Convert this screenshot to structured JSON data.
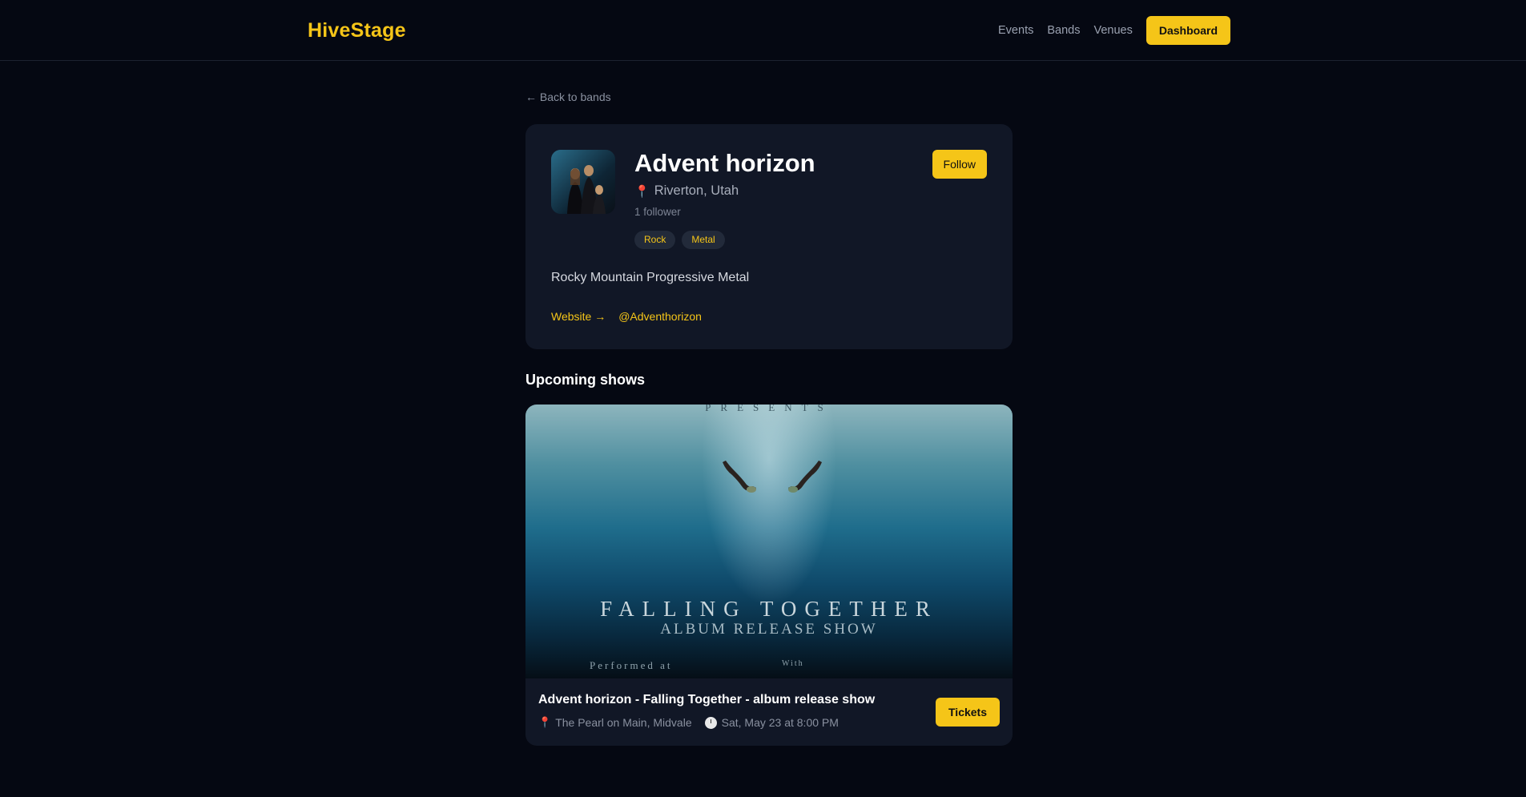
{
  "header": {
    "brand": "HiveStage",
    "nav": [
      "Events",
      "Bands",
      "Venues"
    ],
    "dashboard_label": "Dashboard"
  },
  "back_link": "← Back to bands",
  "band": {
    "name": "Advent horizon",
    "location": "Riverton, Utah",
    "followers": "1 follower",
    "tags": [
      "Rock",
      "Metal"
    ],
    "follow_label": "Follow",
    "bio": "Rocky Mountain Progressive Metal",
    "links": [
      "Website →",
      "@Adventhorizon"
    ]
  },
  "upcoming": {
    "title": "Upcoming shows",
    "shows": [
      {
        "poster_top": "PRESENTS",
        "poster_title": "FALLING TOGETHER",
        "poster_subtitle": "ALBUM RELEASE SHOW",
        "poster_performed": "Performed at",
        "poster_with": "With",
        "title": "Advent horizon - Falling Together - album release show",
        "venue": "The Pearl on Main, Midvale",
        "datetime": "Sat, May 23 at 8:00 PM",
        "tickets_label": "Tickets"
      }
    ]
  },
  "colors": {
    "accent": "#f5c518",
    "background": "#050812",
    "card": "#111726"
  }
}
